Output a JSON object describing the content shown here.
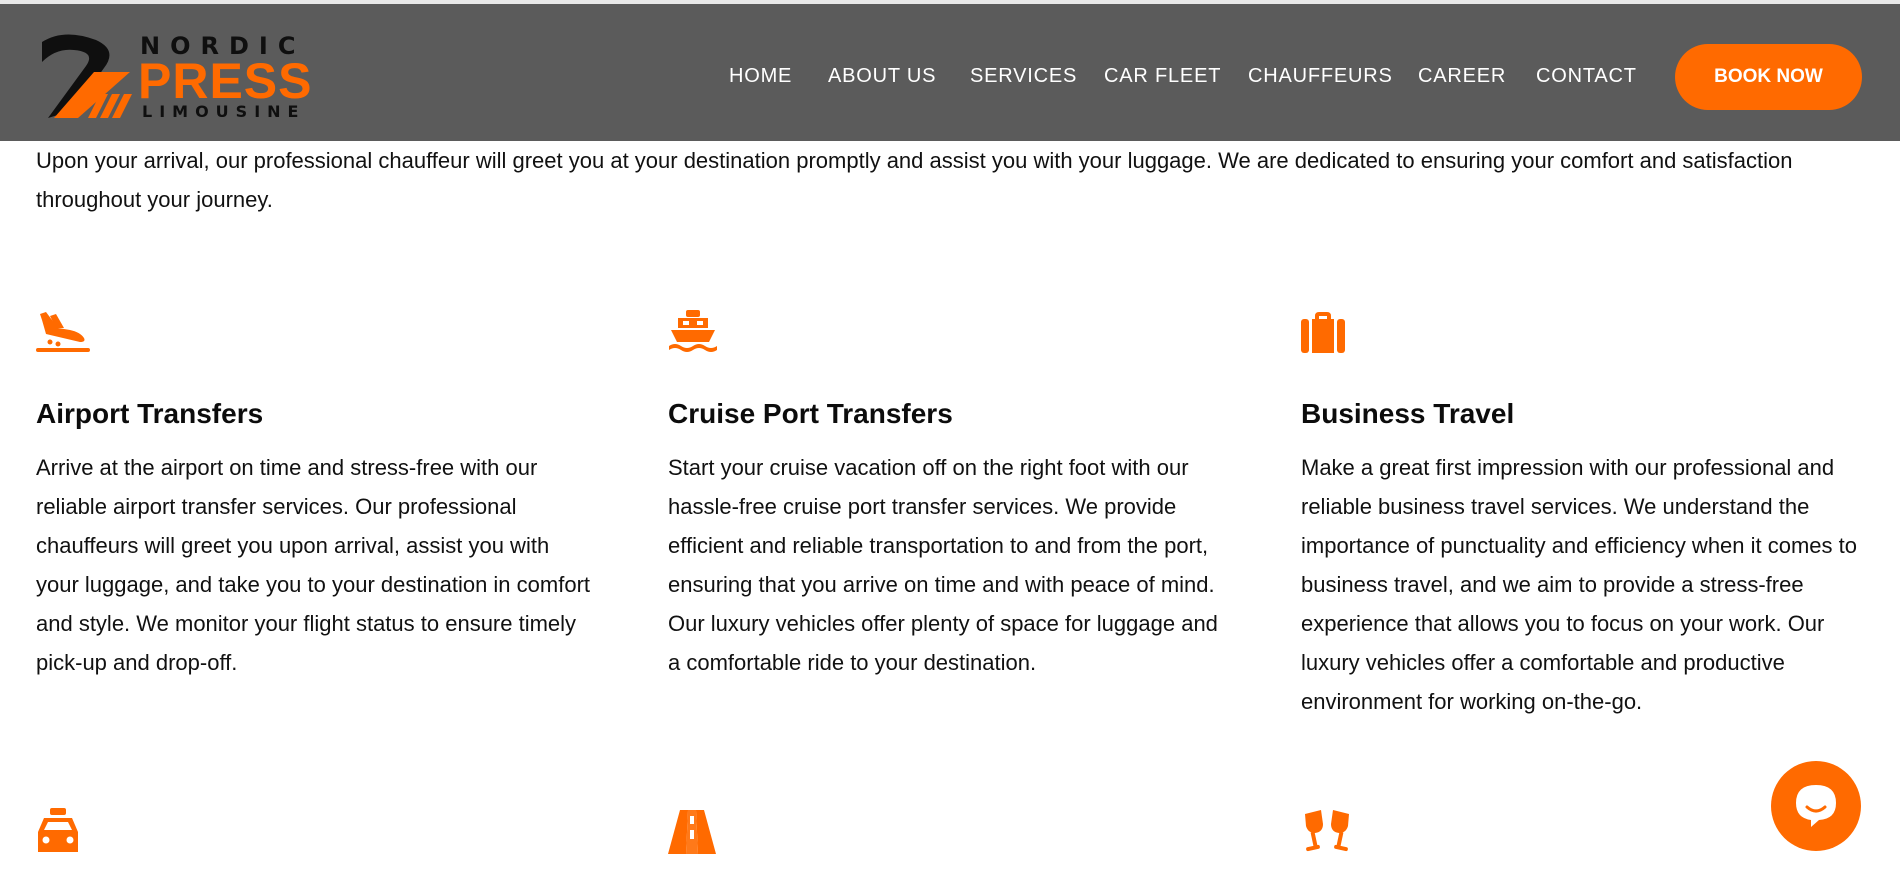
{
  "brand": {
    "logo_top": "NORDIC",
    "logo_mid": "PRESS",
    "logo_bot": "LIMOUSINE",
    "accent_color": "#ff6a00",
    "header_color": "#5b5b5b"
  },
  "nav": {
    "items": [
      {
        "label": "HOME"
      },
      {
        "label": "ABOUT US"
      },
      {
        "label": "SERVICES"
      },
      {
        "label": "CAR FLEET"
      },
      {
        "label": "CHAUFFEURS"
      },
      {
        "label": "CAREER"
      },
      {
        "label": "CONTACT"
      }
    ],
    "cta_label": "BOOK NOW"
  },
  "intro_text": "Upon your arrival, our professional chauffeur will greet you at your destination promptly and assist you with your luggage. We are dedicated to ensuring your comfort and satisfaction throughout your journey.",
  "services": [
    {
      "icon": "plane-landing-icon",
      "title": "Airport Transfers",
      "text": "Arrive at the airport on time and stress-free with our reliable airport transfer services. Our professional chauffeurs will greet you upon arrival, assist you with your luggage, and take you to your destination in comfort and style. We monitor your flight status to ensure timely pick-up and drop-off."
    },
    {
      "icon": "ship-icon",
      "title": "Cruise Port Transfers",
      "text": "Start your cruise vacation off on the right foot with our hassle-free cruise port transfer services. We provide efficient and reliable transportation to and from the port, ensuring that you arrive on time and with peace of mind. Our luxury vehicles offer plenty of space for luggage and a comfortable ride to your destination."
    },
    {
      "icon": "briefcase-icon",
      "title": "Business Travel",
      "text": "Make a great first impression with our professional and reliable business travel services. We understand the importance of punctuality and efficiency when it comes to business travel, and we aim to provide a stress-free experience that allows you to focus on your work. Our luxury vehicles offer a comfortable and productive environment for working on-the-go."
    }
  ],
  "lower_icons": [
    "taxi-icon",
    "road-icon",
    "champagne-glasses-icon"
  ],
  "chat": {
    "icon": "chat-bubble-icon"
  }
}
